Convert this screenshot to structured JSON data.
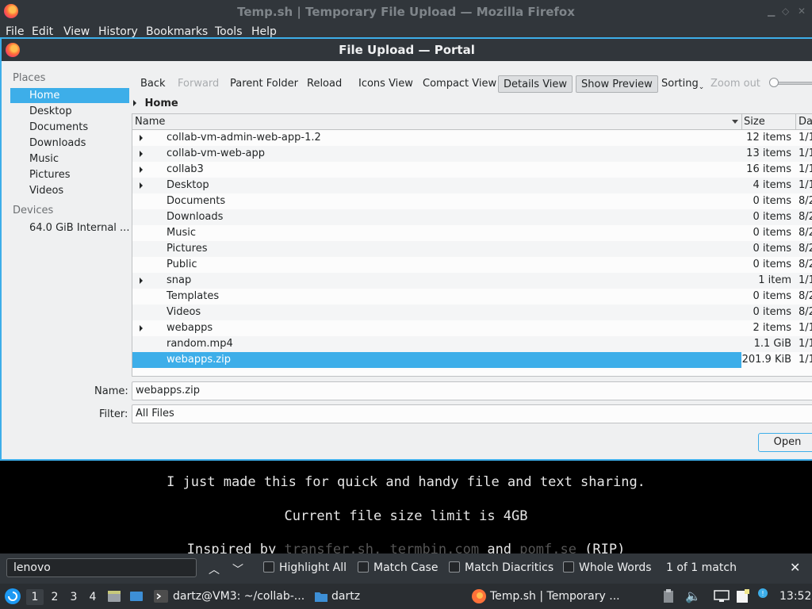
{
  "browser": {
    "window_title": "Temp.sh | Temporary File Upload — Mozilla Firefox",
    "menu": [
      "File",
      "Edit",
      "View",
      "History",
      "Bookmarks",
      "Tools",
      "Help"
    ]
  },
  "dialog": {
    "title": "File Upload — Portal",
    "places": {
      "header": "Places",
      "items": [
        "Home",
        "Desktop",
        "Documents",
        "Downloads",
        "Music",
        "Pictures",
        "Videos"
      ],
      "selected": "Home"
    },
    "devices": {
      "header": "Devices",
      "items": [
        "64.0 GiB Internal ..."
      ]
    },
    "toolbar": {
      "back": "Back",
      "forward": "Forward",
      "parent": "Parent Folder",
      "reload": "Reload",
      "icons_view": "Icons View",
      "compact_view": "Compact View",
      "details_view": "Details View",
      "show_preview": "Show Preview",
      "sorting": "Sorting",
      "zoom_out": "Zoom out"
    },
    "breadcrumb": "Home",
    "columns": {
      "name": "Name",
      "size": "Size",
      "date": "Dat"
    },
    "files": [
      {
        "name": "collab-vm-admin-web-app-1.2",
        "size": "12 items",
        "date": "1/1",
        "dir": true
      },
      {
        "name": "collab-vm-web-app",
        "size": "13 items",
        "date": "1/1",
        "dir": true
      },
      {
        "name": "collab3",
        "size": "16 items",
        "date": "1/1",
        "dir": true
      },
      {
        "name": "Desktop",
        "size": "4 items",
        "date": "1/1",
        "dir": true
      },
      {
        "name": "Documents",
        "size": "0 items",
        "date": "8/2",
        "dir": false
      },
      {
        "name": "Downloads",
        "size": "0 items",
        "date": "8/2",
        "dir": false
      },
      {
        "name": "Music",
        "size": "0 items",
        "date": "8/2",
        "dir": false
      },
      {
        "name": "Pictures",
        "size": "0 items",
        "date": "8/2",
        "dir": false
      },
      {
        "name": "Public",
        "size": "0 items",
        "date": "8/2",
        "dir": false
      },
      {
        "name": "snap",
        "size": "1 item",
        "date": "1/1",
        "dir": true
      },
      {
        "name": "Templates",
        "size": "0 items",
        "date": "8/2",
        "dir": false
      },
      {
        "name": "Videos",
        "size": "0 items",
        "date": "8/2",
        "dir": false
      },
      {
        "name": "webapps",
        "size": "2 items",
        "date": "1/1",
        "dir": true
      },
      {
        "name": "random.mp4",
        "size": "1.1 GiB",
        "date": "1/1",
        "dir": false
      },
      {
        "name": "webapps.zip",
        "size": "201.9 KiB",
        "date": "1/1",
        "dir": false,
        "selected": true
      }
    ],
    "name_label": "Name:",
    "name_value": "webapps.zip",
    "filter_label": "Filter:",
    "filter_value": "All Files",
    "open_button": "Open"
  },
  "page": {
    "line1": "I just made this for quick and handy file and text sharing.",
    "line2": "Current file size limit is 4GB",
    "line3_a": "Inspired by ",
    "line3_b": "transfer.sh, termbin.com",
    "line3_c": " and ",
    "line3_d": "pomf.se",
    "line3_e": " (RIP)"
  },
  "findbar": {
    "query": "lenovo",
    "highlight_all": "Highlight All",
    "match_case": "Match Case",
    "match_diacritics": "Match Diacritics",
    "whole_words": "Whole Words",
    "status": "1 of 1 match"
  },
  "taskbar": {
    "workspaces": [
      "1",
      "2",
      "3",
      "4"
    ],
    "terminal_task": "dartz@VM3: ~/collab-...",
    "folder_task": "dartz",
    "firefox_task": "Temp.sh | Temporary ...",
    "clock": "13:52"
  },
  "colors": {
    "accent": "#3daee9",
    "titlebar": "#31363b",
    "panel": "#eff0f1"
  }
}
